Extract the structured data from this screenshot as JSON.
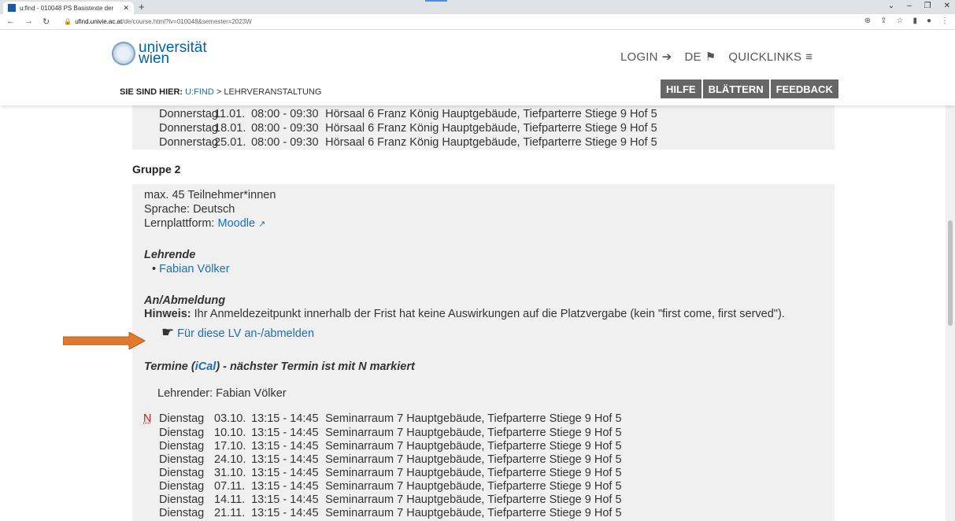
{
  "browser": {
    "tab_title": "u:find - 010048 PS Basistexte der",
    "url_host": "ufind.univie.ac.at",
    "url_path": "/de/course.html?lv=010048&semester=2023W"
  },
  "header": {
    "logo_line1": "universität",
    "logo_line2": "wien",
    "login": "LOGIN",
    "lang": "DE",
    "quicklinks": "QUICKLINKS",
    "breadcrumb_label": "SIE SIND HIER:",
    "breadcrumb_link": "U:FIND",
    "breadcrumb_current": " > LEHRVERANSTALTUNG",
    "btn_help": "HILFE",
    "btn_browse": "BLÄTTERN",
    "btn_feedback": "FEEDBACK"
  },
  "group1_dates": [
    {
      "day": "Donnerstag",
      "date": "11.01.",
      "time": "08:00 - 09:30",
      "room": "Hörsaal 6 Franz König Hauptgebäude, Tiefparterre Stiege 9 Hof 5"
    },
    {
      "day": "Donnerstag",
      "date": "18.01.",
      "time": "08:00 - 09:30",
      "room": "Hörsaal 6 Franz König Hauptgebäude, Tiefparterre Stiege 9 Hof 5"
    },
    {
      "day": "Donnerstag",
      "date": "25.01.",
      "time": "08:00 - 09:30",
      "room": "Hörsaal 6 Franz König Hauptgebäude, Tiefparterre Stiege 9 Hof 5"
    }
  ],
  "group2": {
    "title": "Gruppe 2",
    "max": "max. 45 Teilnehmer*innen",
    "language": "Sprache: Deutsch",
    "platform_label": "Lernplattform: ",
    "platform_link": "Moodle",
    "lecturers_heading": "Lehrende",
    "lecturer": "Fabian Völker",
    "registration_heading": "An/Abmeldung",
    "hint_label": "Hinweis:",
    "hint_text": " Ihr Anmeldezeitpunkt innerhalb der Frist hat keine Auswirkungen auf die Platzvergabe (kein \"first come, first served\").",
    "register_link": "Für diese LV an-/abmelden",
    "termine_label": "Termine (",
    "ical": "iCal",
    "termine_suffix": ") - nächster Termin ist mit N markiert",
    "lecturer_line": "Lehrender: Fabian Völker",
    "next_marker": "N",
    "dates": [
      {
        "day": "Dienstag",
        "date": "03.10.",
        "time": "13:15 - 14:45",
        "room": "Seminarraum 7 Hauptgebäude, Tiefparterre Stiege 9 Hof 5"
      },
      {
        "day": "Dienstag",
        "date": "10.10.",
        "time": "13:15 - 14:45",
        "room": "Seminarraum 7 Hauptgebäude, Tiefparterre Stiege 9 Hof 5"
      },
      {
        "day": "Dienstag",
        "date": "17.10.",
        "time": "13:15 - 14:45",
        "room": "Seminarraum 7 Hauptgebäude, Tiefparterre Stiege 9 Hof 5"
      },
      {
        "day": "Dienstag",
        "date": "24.10.",
        "time": "13:15 - 14:45",
        "room": "Seminarraum 7 Hauptgebäude, Tiefparterre Stiege 9 Hof 5"
      },
      {
        "day": "Dienstag",
        "date": "31.10.",
        "time": "13:15 - 14:45",
        "room": "Seminarraum 7 Hauptgebäude, Tiefparterre Stiege 9 Hof 5"
      },
      {
        "day": "Dienstag",
        "date": "07.11.",
        "time": "13:15 - 14:45",
        "room": "Seminarraum 7 Hauptgebäude, Tiefparterre Stiege 9 Hof 5"
      },
      {
        "day": "Dienstag",
        "date": "14.11.",
        "time": "13:15 - 14:45",
        "room": "Seminarraum 7 Hauptgebäude, Tiefparterre Stiege 9 Hof 5"
      },
      {
        "day": "Dienstag",
        "date": "21.11.",
        "time": "13:15 - 14:45",
        "room": "Seminarraum 7 Hauptgebäude, Tiefparterre Stiege 9 Hof 5"
      }
    ]
  },
  "colors": {
    "link": "#1a6fb5",
    "next": "#c0202a",
    "arrow": "#e07a2e",
    "panel": "#f0f0f0"
  }
}
